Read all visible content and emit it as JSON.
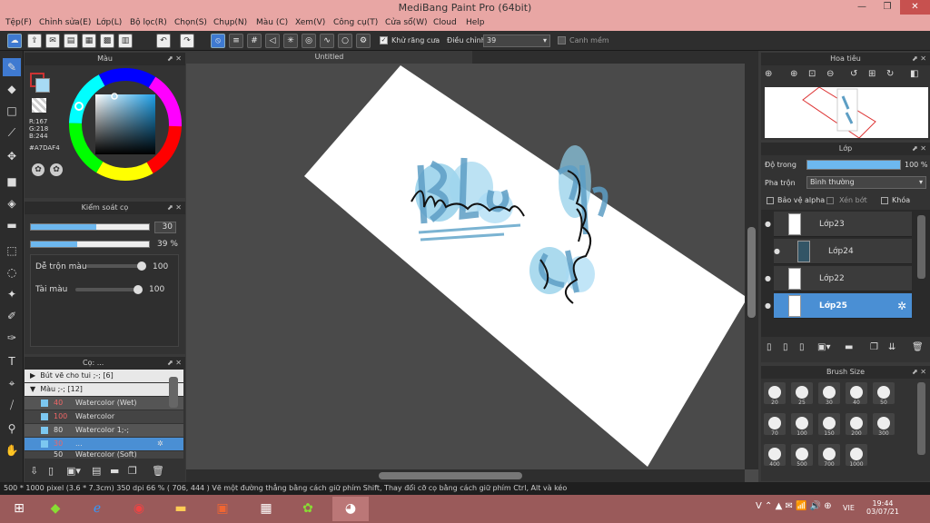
{
  "window": {
    "title": "MediBang Paint Pro (64bit)"
  },
  "menu": [
    "Tệp(F)",
    "Chỉnh sửa(E)",
    "Lớp(L)",
    "Bộ lọc(R)",
    "Chọn(S)",
    "Chụp(N)",
    "Màu (C)",
    "Xem(V)",
    "Công cụ(T)",
    "Cửa sổ(W)",
    "Cloud",
    "Help"
  ],
  "toolbar": {
    "antialias_label": "Khử răng cưa",
    "adjust_label": "Điều chỉnh",
    "adjust_value": "39",
    "snap_label": "Canh mềm"
  },
  "color_panel": {
    "title": "Màu",
    "r": "R:167",
    "g": "G:218",
    "b": "B:244",
    "hex": "#A7DAF4",
    "current_color": "#A7DAF4"
  },
  "brush_control": {
    "title": "Kiểm soát cọ",
    "size_value": "30",
    "opacity_value": "39 %",
    "smooth_label": "Dễ trộn màu",
    "smooth_value": "100",
    "amount_label": "Tài màu",
    "amount_value": "100",
    "size_fraction": 0.55,
    "opacity_fraction": 0.39
  },
  "brush_list": {
    "title": "Cọ: ...",
    "groups": [
      {
        "label": "Bút vẽ cho tui ;-; [6]"
      },
      {
        "label": "Màu ;-; [12]"
      }
    ],
    "items": [
      {
        "size": "40",
        "name": "Watercolor (Wet)"
      },
      {
        "size": "100",
        "name": "Watercolor"
      },
      {
        "size": "80",
        "name": "Watercolor 1;-;"
      },
      {
        "size": "30",
        "name": "..."
      },
      {
        "size": "50",
        "name": "Watercolor (Soft)"
      }
    ]
  },
  "canvas": {
    "tab": "Untitled"
  },
  "navigator": {
    "title": "Hoa tiêu"
  },
  "layers": {
    "title": "Lớp",
    "opacity_label": "Độ trong",
    "opacity_value": "100 %",
    "opacity_fraction": 1.0,
    "blend_label": "Pha trộn",
    "blend_value": "Bình thường",
    "protect_label": "Bảo vệ alpha",
    "clip_label": "Xén bớt",
    "lock_label": "Khóa",
    "items": [
      {
        "name": "Lớp23"
      },
      {
        "name": "Lớp24"
      },
      {
        "name": "Lớp22"
      },
      {
        "name": "Lớp25"
      }
    ]
  },
  "brush_size": {
    "title": "Brush Size",
    "sizes": [
      "20",
      "25",
      "30",
      "40",
      "50",
      "70",
      "100",
      "150",
      "200",
      "300",
      "400",
      "500",
      "700",
      "1000"
    ]
  },
  "status": {
    "text": "500 * 1000 pixel   (3.6 * 7.3cm)   350 dpi   66 %   ( 706, 444 )   Vẽ một đường thẳng bằng cách giữ phím Shift, Thay đổi cỡ cọ bằng cách giữ phím Ctrl, Alt và kéo"
  },
  "taskbar": {
    "lang": "VIE",
    "time": "19:44",
    "date": "03/07/21"
  }
}
